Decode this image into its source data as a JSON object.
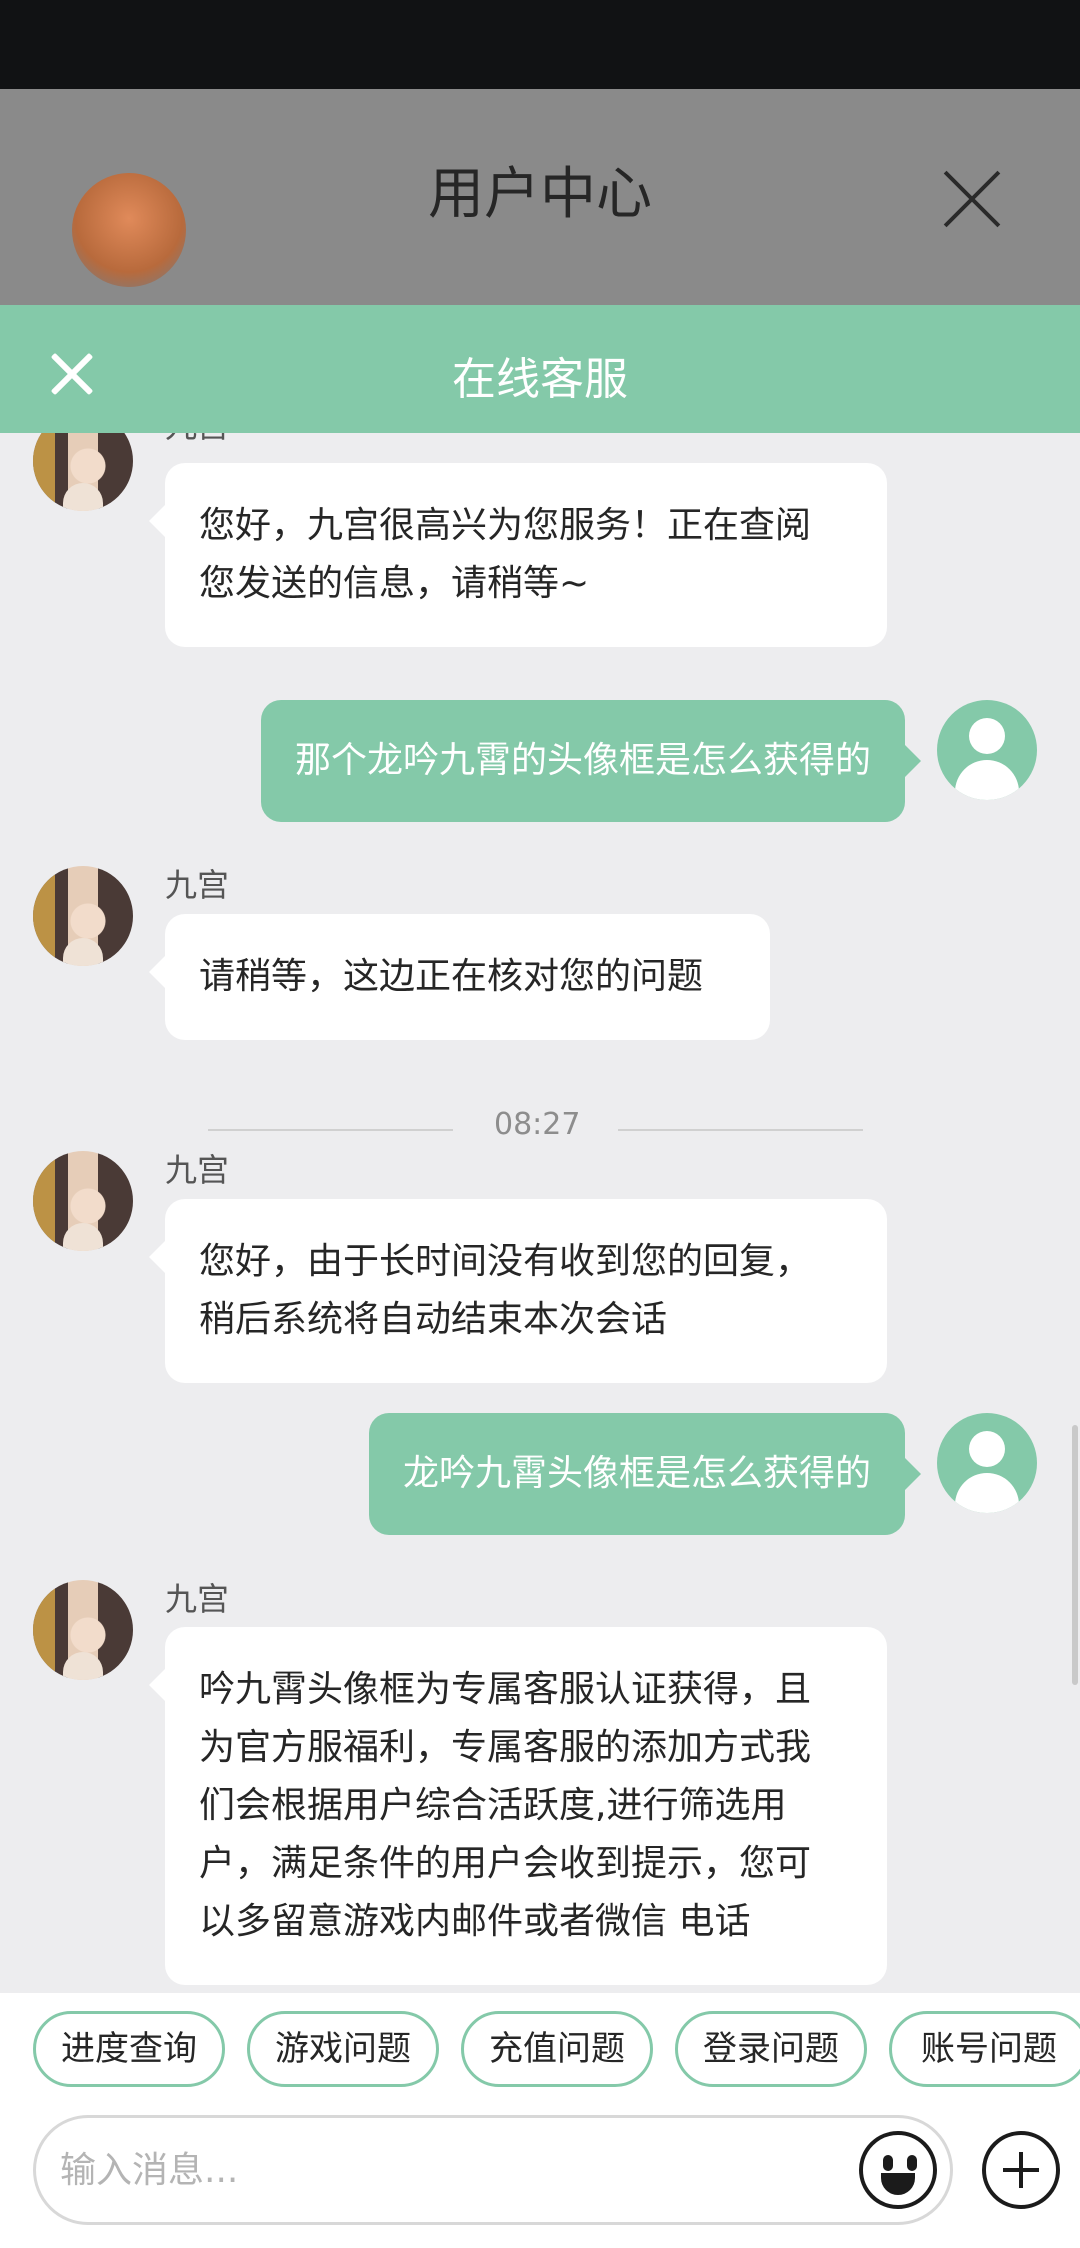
{
  "underlay": {
    "title": "用户中心"
  },
  "header": {
    "title": "在线客服"
  },
  "messages": [
    {
      "from": "agent",
      "sender": "九宫",
      "lines": [
        "您好，九宫很高兴为您服务！正在查阅",
        "您发送的信息，请稍等~"
      ]
    },
    {
      "from": "user",
      "text": "那个龙吟九霄的头像框是怎么获得的"
    },
    {
      "from": "agent",
      "sender": "九宫",
      "lines": [
        "请稍等，这边正在核对您的问题"
      ]
    },
    {
      "from": "agent",
      "sender": "九宫",
      "lines": [
        "您好，由于长时间没有收到您的回复，",
        "稍后系统将自动结束本次会话"
      ]
    },
    {
      "from": "user",
      "text": "龙吟九霄头像框是怎么获得的"
    },
    {
      "from": "agent",
      "sender": "九宫",
      "lines": [
        "吟九霄头像框为专属客服认证获得，且",
        "为官方服福利，专属客服的添加方式我",
        "们会根据用户综合活跃度,进行筛选用",
        "户，满足条件的用户会收到提示，您可",
        "以多留意游戏内邮件或者微信 电话"
      ]
    }
  ],
  "divider": {
    "time": "08:27"
  },
  "quick_replies": [
    "进度查询",
    "游戏问题",
    "充值问题",
    "登录问题",
    "账号问题"
  ],
  "input": {
    "placeholder": "输入消息..."
  },
  "colors": {
    "accent": "#84c9a9",
    "background": "#ededef"
  }
}
